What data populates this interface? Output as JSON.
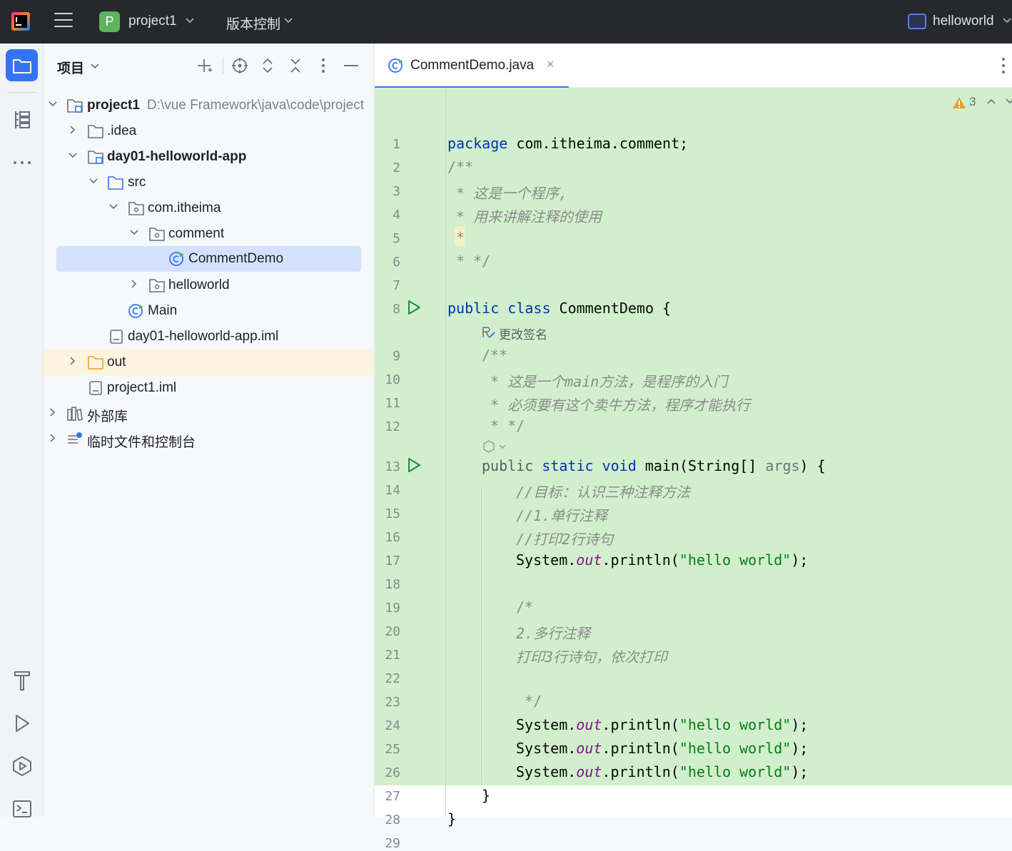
{
  "titlebar": {
    "project_badge": "P",
    "project_name": "project1",
    "vcs_label": "版本控制",
    "run_config": "helloworld"
  },
  "panel": {
    "title": "项目",
    "tree": [
      {
        "label": "project1",
        "path": "D:\\vue  Framework\\java\\code\\project",
        "bold": true
      },
      {
        "label": ".idea"
      },
      {
        "label": "day01-helloworld-app",
        "bold": true
      },
      {
        "label": "src"
      },
      {
        "label": "com.itheima"
      },
      {
        "label": "comment"
      },
      {
        "label": "CommentDemo",
        "selected": true
      },
      {
        "label": "helloworld"
      },
      {
        "label": "Main"
      },
      {
        "label": "day01-helloworld-app.iml"
      },
      {
        "label": "out"
      },
      {
        "label": "project1.iml"
      },
      {
        "label": "外部库"
      },
      {
        "label": "临时文件和控制台"
      }
    ]
  },
  "editor": {
    "tab_label": "CommentDemo.java",
    "tab_close": "×",
    "warning_count": "3",
    "inlay_hint": "更改签名",
    "line_numbers": [
      "1",
      "2",
      "3",
      "4",
      "5",
      "6",
      "7",
      "8",
      "9",
      "10",
      "11",
      "12",
      "13",
      "14",
      "15",
      "16",
      "17",
      "18",
      "19",
      "20",
      "21",
      "22",
      "23",
      "24",
      "25",
      "26",
      "27",
      "28",
      "29"
    ],
    "code": {
      "l1_kw": "package",
      "l1_rest": " com.itheima.comment;",
      "l2": "/**",
      "l3": " * 这是一个程序,",
      "l4": " * 用来讲解注释的使用",
      "l5": " *",
      "l6": " * */",
      "l8_kw": "public class",
      "l8_rest": " CommentDemo {",
      "l9": "/**",
      "l10": " * 这是一个main方法，是程序的入门",
      "l11": " * 必须要有这个卖牛方法，程序才能执行",
      "l12": " * */",
      "l13_a": "public ",
      "l13_kw": "static void",
      "l13_b": " main(String[] ",
      "l13_param": "args",
      "l13_c": ") {",
      "l14": "//目标：认识三种注释方法",
      "l15": "//1.单行注释",
      "l16": "//打印2行诗句",
      "sys": "System.",
      "out": "out",
      "println": ".println(",
      "str": "\"hello world\"",
      "end": ");",
      "l19": "/*",
      "l20": "2.多行注释",
      "l21": "打印3行诗句，依次打印",
      "l23": " */",
      "l27": "}",
      "l28": "}"
    }
  }
}
